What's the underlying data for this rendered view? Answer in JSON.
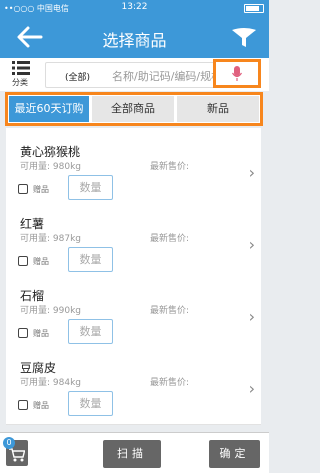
{
  "status_bar": {
    "carrier": "••○○○ 中国电信",
    "time": "13:22"
  },
  "header": {
    "title": "选择商品",
    "back_icon": "back-arrow-icon",
    "filter_icon": "funnel-icon"
  },
  "search": {
    "category_label": "分类",
    "scope": "(全部)",
    "placeholder": "名称/助记码/编码/规格..."
  },
  "tabs": [
    {
      "label": "最近60天订购",
      "active": true
    },
    {
      "label": "全部商品",
      "active": false
    },
    {
      "label": "新品",
      "active": false
    }
  ],
  "items": [
    {
      "name": "黄心猕猴桃",
      "stock": "可用量: 980kg",
      "last_price": "最新售价:",
      "gift": "赠品",
      "qty_placeholder": "数量"
    },
    {
      "name": "红薯",
      "stock": "可用量: 987kg",
      "last_price": "最新售价:",
      "gift": "赠品",
      "qty_placeholder": "数量"
    },
    {
      "name": "石榴",
      "stock": "可用量: 990kg",
      "last_price": "最新售价:",
      "gift": "赠品",
      "qty_placeholder": "数量"
    },
    {
      "name": "豆腐皮",
      "stock": "可用量: 984kg",
      "last_price": "最新售价:",
      "gift": "赠品",
      "qty_placeholder": "数量"
    }
  ],
  "bottom": {
    "cart_count": "0",
    "scan_label": "扫描",
    "confirm_label": "确定"
  },
  "colors": {
    "accent": "#3d98d8",
    "highlight": "#f7861d",
    "button_gray": "#666666"
  }
}
